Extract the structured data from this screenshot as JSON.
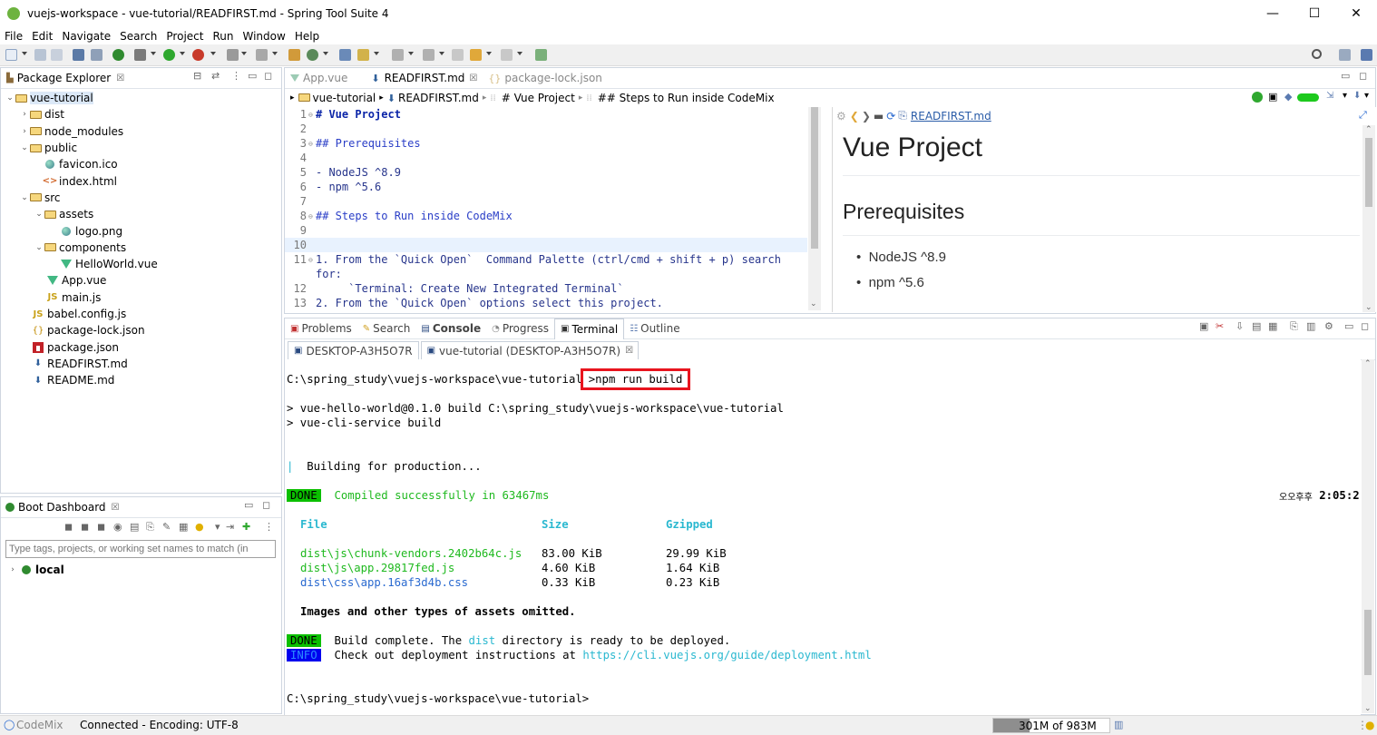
{
  "window": {
    "title": "vuejs-workspace - vue-tutorial/READFIRST.md - Spring Tool Suite 4",
    "minimize": "—",
    "maximize": "☐",
    "close": "✕"
  },
  "menu": [
    "File",
    "Edit",
    "Navigate",
    "Search",
    "Project",
    "Run",
    "Window",
    "Help"
  ],
  "package_explorer": {
    "title": "Package Explorer",
    "close": "☒",
    "items": [
      {
        "label": "vue-tutorial",
        "icon": "project-icon"
      },
      {
        "label": "dist",
        "icon": "folder-icon"
      },
      {
        "label": "node_modules",
        "icon": "folder-icon"
      },
      {
        "label": "public",
        "icon": "folder-icon"
      },
      {
        "label": "favicon.ico",
        "icon": "image-icon"
      },
      {
        "label": "index.html",
        "icon": "html-icon"
      },
      {
        "label": "src",
        "icon": "folder-icon"
      },
      {
        "label": "assets",
        "icon": "folder-icon"
      },
      {
        "label": "logo.png",
        "icon": "image-icon"
      },
      {
        "label": "components",
        "icon": "folder-icon"
      },
      {
        "label": "HelloWorld.vue",
        "icon": "vue-icon"
      },
      {
        "label": "App.vue",
        "icon": "vue-icon"
      },
      {
        "label": "main.js",
        "icon": "js-icon"
      },
      {
        "label": "babel.config.js",
        "icon": "js-icon"
      },
      {
        "label": "package-lock.json",
        "icon": "json-icon"
      },
      {
        "label": "package.json",
        "icon": "npm-icon"
      },
      {
        "label": "READFIRST.md",
        "icon": "markdown-icon"
      },
      {
        "label": "README.md",
        "icon": "markdown-icon"
      }
    ]
  },
  "boot_dashboard": {
    "title": "Boot Dashboard",
    "close": "☒",
    "filter_placeholder": "Type tags, projects, or working set names to match (in",
    "local_label": "local"
  },
  "editor": {
    "tabs": [
      {
        "label": "App.vue",
        "active": false
      },
      {
        "label": "READFIRST.md",
        "active": true,
        "close": "☒"
      },
      {
        "label": "package-lock.json",
        "active": false
      }
    ],
    "breadcrumb": [
      "vue-tutorial",
      "READFIRST.md",
      "# Vue Project",
      "## Steps to Run inside CodeMix"
    ],
    "lines": [
      {
        "n": "1",
        "text": "# Vue Project",
        "style": "h1",
        "fold": true
      },
      {
        "n": "2",
        "text": "",
        "style": "plain"
      },
      {
        "n": "3",
        "text": "## Prerequisites",
        "style": "h2",
        "fold": true
      },
      {
        "n": "4",
        "text": "",
        "style": "plain"
      },
      {
        "n": "5",
        "text": "- NodeJS ^8.9",
        "style": "plain"
      },
      {
        "n": "6",
        "text": "- npm ^5.6",
        "style": "plain"
      },
      {
        "n": "7",
        "text": "",
        "style": "plain"
      },
      {
        "n": "8",
        "text": "## Steps to Run inside CodeMix",
        "style": "h2",
        "fold": true
      },
      {
        "n": "9",
        "text": "",
        "style": "plain"
      },
      {
        "n": "10",
        "text": "",
        "style": "plain"
      },
      {
        "n": "11",
        "text": "1. From the `Quick Open`  Command Palette (ctrl/cmd + shift + p) search",
        "style": "plain",
        "fold": true
      },
      {
        "n": "",
        "text": "for:",
        "style": "plain"
      },
      {
        "n": "12",
        "text": "     `Terminal: Create New Integrated Terminal`",
        "style": "plain"
      },
      {
        "n": "13",
        "text": "2. From the `Quick Open` options select this project.",
        "style": "plain"
      }
    ],
    "preview": {
      "file_link": "READFIRST.md",
      "h1": "Vue Project",
      "h2": "Prerequisites",
      "bullets": [
        "NodeJS ^8.9",
        "npm ^5.6"
      ]
    }
  },
  "bottom_panel": {
    "tabs": [
      "Problems",
      "Search",
      "Console",
      "Progress",
      "Terminal",
      "Outline"
    ],
    "terminal_tabs": [
      "DESKTOP-A3H5O7R",
      "vue-tutorial (DESKTOP-A3H5O7R)"
    ],
    "terminal_tab_close": "☒",
    "terminal": {
      "prompt1": "C:\\spring_study\\vuejs-workspace\\vue-tutorial",
      "cmd": ">npm run build",
      "out1": "> vue-hello-world@0.1.0 build C:\\spring_study\\vuejs-workspace\\vue-tutorial",
      "out2": "> vue-cli-service build",
      "building": "Building for production...",
      "spinner": "|",
      "done_badge": "DONE",
      "compiled": "Compiled successfully in 63467ms",
      "time_prefix": "오오후후",
      "time": "2:05:2",
      "hdr_file": "File",
      "hdr_size": "Size",
      "hdr_gz": "Gzipped",
      "rows": [
        {
          "file": "dist\\js\\chunk-vendors.2402b64c.js",
          "size": "83.00 KiB",
          "gz": "29.99 KiB",
          "color": "green"
        },
        {
          "file": "dist\\js\\app.29817fed.js",
          "size": "4.60 KiB",
          "gz": "1.64 KiB",
          "color": "green"
        },
        {
          "file": "dist\\css\\app.16af3d4b.css",
          "size": "0.33 KiB",
          "gz": "0.23 KiB",
          "color": "blue"
        }
      ],
      "omitted": "Images and other types of assets omitted.",
      "build_done_1": "Build complete. The ",
      "build_done_dist": "dist",
      "build_done_2": " directory is ready to be deployed.",
      "info_badge": "INFO",
      "info_text": "Check out deployment instructions at ",
      "info_link": "https://cli.vuejs.org/guide/deployment.html",
      "prompt2": "C:\\spring_study\\vuejs-workspace\\vue-tutorial>"
    }
  },
  "status": {
    "codemix": "CodeMix",
    "connection": "Connected - Encoding: UTF-8",
    "memory": "301M of 983M",
    "memory_used_fraction": 0.31
  }
}
